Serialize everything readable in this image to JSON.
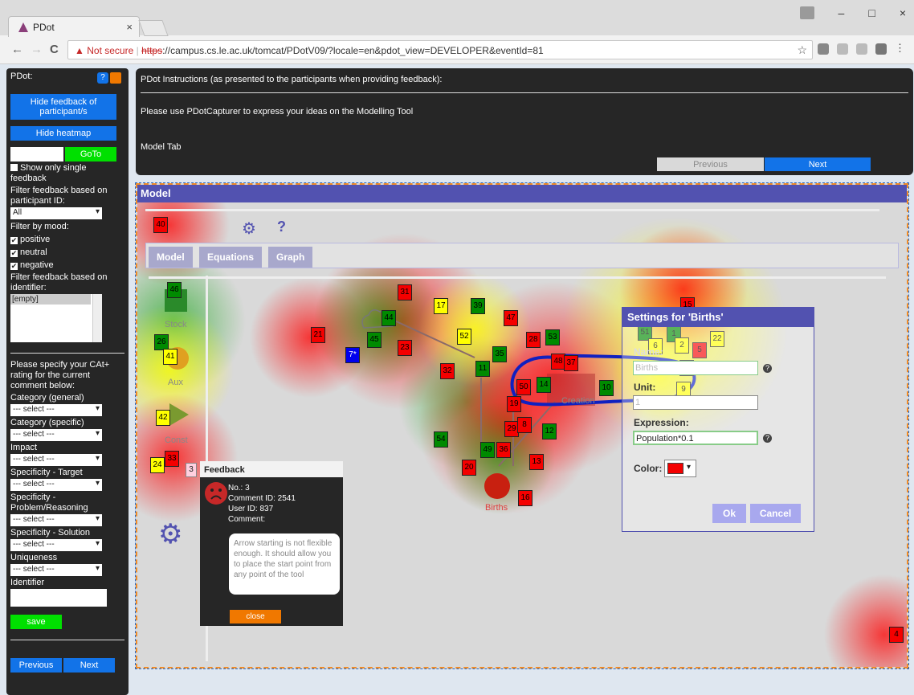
{
  "browser": {
    "tab_title": "PDot",
    "close": "×",
    "url_warning": "Not secure",
    "url_scheme": "https",
    "url_rest": "://campus.cs.le.ac.uk/tomcat/PDotV09/?locale=en&pdot_view=DEVELOPER&eventId=81",
    "back": "←",
    "forward": "→",
    "reload": "C",
    "star": "☆",
    "minimize": "–",
    "maximize": "□",
    "close_window": "×"
  },
  "left": {
    "title": "PDot:",
    "hide_feedback": "Hide feedback of participant/s",
    "hide_heatmap": "Hide heatmap",
    "goto": "GoTo",
    "single_feedback": "Show only single feedback",
    "filter_participant": "Filter feedback based on participant ID:",
    "participant_value": "All",
    "filter_mood": "Filter by mood:",
    "positive": "positive",
    "neutral": "neutral",
    "negative": "negative",
    "filter_identifier": "Filter feedback based on identifier:",
    "identifier_item": "[empty]",
    "cat_prompt": "Please specify your CAt+ rating for the current comment below:",
    "cat_general": "Category (general)",
    "cat_specific": "Category (specific)",
    "impact": "Impact",
    "spec_target": "Specificity - Target",
    "spec_problem": "Specificity - Problem/Reasoning",
    "spec_solution": "Specificity - Solution",
    "uniqueness": "Uniqueness",
    "identifier": "Identifier",
    "select": "--- select ---",
    "save": "save",
    "previous": "Previous",
    "next": "Next"
  },
  "top": {
    "instructions": "PDot Instructions (as presented to the participants when providing feedback):",
    "line2": "Please use PDotCapturer to express your ideas on the Modelling Tool",
    "line3": "Model Tab",
    "previous": "Previous",
    "next": "Next"
  },
  "model": {
    "title": "Model",
    "tabs": [
      "Model",
      "Equations",
      "Graph"
    ],
    "palette": [
      "Stock",
      "Aux",
      "Const"
    ],
    "births_label": "Births",
    "creation_label": "Creation",
    "gear": "⚙",
    "help": "?"
  },
  "settings": {
    "title": "Settings for 'Births'",
    "name_label": "Name:",
    "name_value": "Births",
    "unit_label": "Unit:",
    "unit_value": "1",
    "expr_label": "Expression:",
    "expr_value": "Population*0.1",
    "color_label": "Color:",
    "ok": "Ok",
    "cancel": "Cancel"
  },
  "feedback": {
    "title": "Feedback",
    "number": "3",
    "no": "No.: 3",
    "comment_id": "Comment ID: 2541",
    "user_id": "User ID: 837",
    "comment_label": "Comment:",
    "comment": "Arrow starting is not flexible enough. It should allow you to place the start point from any point of the tool",
    "close": "close"
  },
  "markers": [
    {
      "n": "40",
      "c": "r"
    },
    {
      "n": "46",
      "c": "g"
    },
    {
      "n": "26",
      "c": "g"
    },
    {
      "n": "41",
      "c": "y"
    },
    {
      "n": "42",
      "c": "y"
    },
    {
      "n": "24",
      "c": "y"
    },
    {
      "n": "33",
      "c": "r"
    },
    {
      "n": "31",
      "c": "r"
    },
    {
      "n": "17",
      "c": "y"
    },
    {
      "n": "39",
      "c": "g"
    },
    {
      "n": "44",
      "c": "g"
    },
    {
      "n": "21",
      "c": "r"
    },
    {
      "n": "45",
      "c": "g"
    },
    {
      "n": "23",
      "c": "r"
    },
    {
      "n": "7*",
      "c": "b"
    },
    {
      "n": "47",
      "c": "r"
    },
    {
      "n": "52",
      "c": "y"
    },
    {
      "n": "28",
      "c": "r"
    },
    {
      "n": "53",
      "c": "g"
    },
    {
      "n": "35",
      "c": "g"
    },
    {
      "n": "48",
      "c": "r"
    },
    {
      "n": "37",
      "c": "r"
    },
    {
      "n": "32",
      "c": "r"
    },
    {
      "n": "11",
      "c": "g"
    },
    {
      "n": "50",
      "c": "r"
    },
    {
      "n": "14",
      "c": "g"
    },
    {
      "n": "10",
      "c": "g"
    },
    {
      "n": "19",
      "c": "r"
    },
    {
      "n": "29",
      "c": "r"
    },
    {
      "n": "8",
      "c": "r"
    },
    {
      "n": "12",
      "c": "g"
    },
    {
      "n": "54",
      "c": "g"
    },
    {
      "n": "49",
      "c": "g"
    },
    {
      "n": "36",
      "c": "r"
    },
    {
      "n": "13",
      "c": "r"
    },
    {
      "n": "20",
      "c": "r"
    },
    {
      "n": "16",
      "c": "r"
    },
    {
      "n": "15",
      "c": "r"
    },
    {
      "n": "51",
      "c": "g"
    },
    {
      "n": "6",
      "c": "y"
    },
    {
      "n": "1",
      "c": "g"
    },
    {
      "n": "2",
      "c": "y"
    },
    {
      "n": "5",
      "c": "r"
    },
    {
      "n": "22",
      "c": "y"
    },
    {
      "n": "18",
      "c": "y"
    },
    {
      "n": "9",
      "c": "y"
    },
    {
      "n": "4",
      "c": "r"
    }
  ]
}
